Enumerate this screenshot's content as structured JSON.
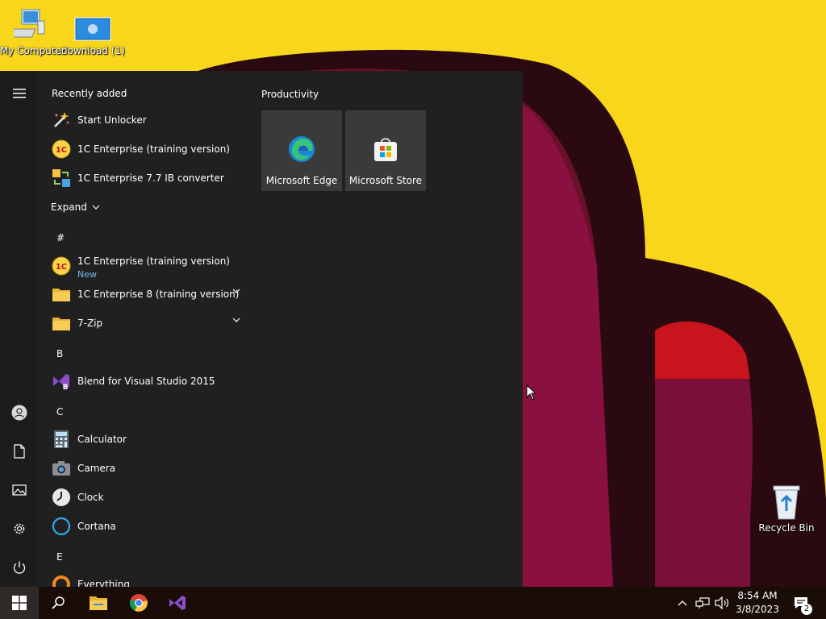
{
  "desktop": {
    "icons": [
      {
        "label": "My Computer",
        "icon": "computer-icon"
      },
      {
        "label": "download (1)",
        "icon": "image-file-icon"
      },
      {
        "label": "Recycle Bin",
        "icon": "recycle-bin-icon"
      }
    ]
  },
  "start_menu": {
    "recently_added_title": "Recently added",
    "recent": [
      {
        "label": "Start Unlocker",
        "icon": "magic-wand-icon"
      },
      {
        "label": "1C Enterprise (training version)",
        "icon": "1c-logo-icon"
      },
      {
        "label": "1C Enterprise 7.7 IB converter",
        "icon": "converter-icon"
      }
    ],
    "expand_label": "Expand",
    "sections": [
      {
        "letter": "#"
      },
      {
        "letter": "B"
      },
      {
        "letter": "C"
      },
      {
        "letter": "E"
      }
    ],
    "apps": [
      {
        "label": "1C Enterprise (training version)",
        "badge": "New",
        "icon": "1c-logo-icon"
      },
      {
        "label": "1C Enterprise 8 (training version)",
        "icon": "folder-icon"
      },
      {
        "label": "7-Zip",
        "icon": "folder-icon"
      },
      {
        "label": "Blend for Visual Studio 2015",
        "icon": "blend-icon"
      },
      {
        "label": "Calculator",
        "icon": "calculator-icon"
      },
      {
        "label": "Camera",
        "icon": "camera-icon"
      },
      {
        "label": "Clock",
        "icon": "clock-icon"
      },
      {
        "label": "Cortana",
        "icon": "cortana-icon"
      },
      {
        "label": "Everything",
        "icon": "everything-icon"
      }
    ],
    "tiles_group_title": "Productivity",
    "tiles": [
      {
        "label": "Microsoft Edge",
        "icon": "edge-icon"
      },
      {
        "label": "Microsoft Store",
        "icon": "store-icon"
      }
    ]
  },
  "taskbar": {
    "time": "8:54 AM",
    "date": "3/8/2023",
    "notification_count": "2"
  },
  "colors": {
    "wallpaper_yellow": "#f7d61c",
    "menu_bg": "#202020",
    "tile_bg": "#3a3a3a",
    "accent_blue": "#7cb9f3"
  }
}
